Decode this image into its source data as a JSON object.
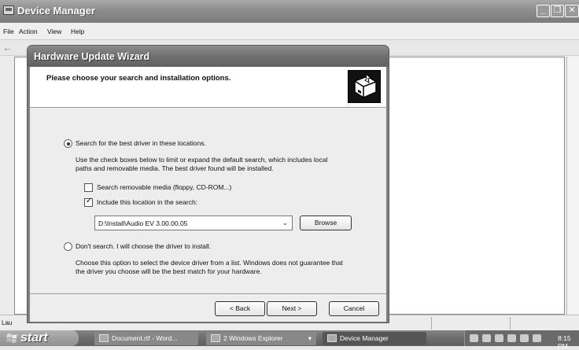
{
  "device_manager": {
    "title": "Device Manager",
    "menu": [
      "File",
      "Action",
      "View",
      "Help"
    ],
    "status_text": "Lau"
  },
  "wizard": {
    "title": "Hardware Update Wizard",
    "header_title": "Please choose your search and installation options.",
    "option_search_label": "Search for the best driver in these locations.",
    "option_search_selected": true,
    "search_desc_1": "Use the check boxes below to limit or expand the default search, which includes local",
    "search_desc_2": "paths and removable media. The best driver found will be installed.",
    "removable_media_label": "Search removable media (floppy, CD-ROM...)",
    "removable_media_checked": false,
    "include_location_label": "Include this location in the search:",
    "include_location_checked": true,
    "location_path": "D:\\Install\\Audio EV 3.00.00.05",
    "browse_label": "Browse",
    "option_dont_search_label": "Don't search. I will choose the driver to install.",
    "option_dont_search_selected": false,
    "dont_search_desc_1": "Choose this option to select the device driver from a list.  Windows does not guarantee that",
    "dont_search_desc_2": "the driver you choose will be the best match for your hardware.",
    "back_label": "< Back",
    "next_label": "Next >",
    "cancel_label": "Cancel"
  },
  "taskbar": {
    "start_label": "start",
    "tasks": [
      {
        "label": "Document.rtf - Word...",
        "active": false
      },
      {
        "label": "2 Windows Explorer",
        "active": false
      },
      {
        "label": "Device Manager",
        "active": true
      }
    ],
    "clock": "8:15 PM"
  }
}
